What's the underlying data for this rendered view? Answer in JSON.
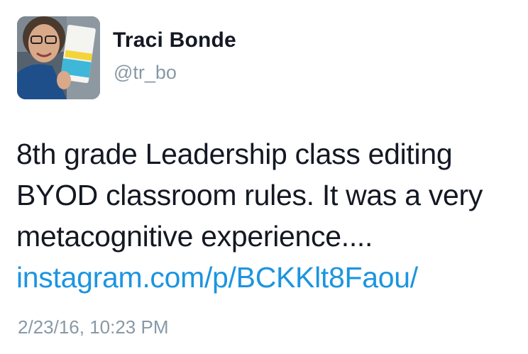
{
  "author": {
    "display_name": "Traci Bonde",
    "handle": "@tr_bo",
    "avatar_icon": "user-photo-avatar"
  },
  "tweet": {
    "text_lines": [
      "8th grade Leadership class editing",
      "BYOD classroom rules. It was a very",
      "metacognitive experience...."
    ],
    "link_text": "instagram.com/p/BCKKlt8Faou/",
    "timestamp": "2/23/16, 10:23 PM"
  },
  "colors": {
    "text": "#141823",
    "muted": "#8899a6",
    "link": "#1b95e0",
    "background": "#ffffff"
  }
}
